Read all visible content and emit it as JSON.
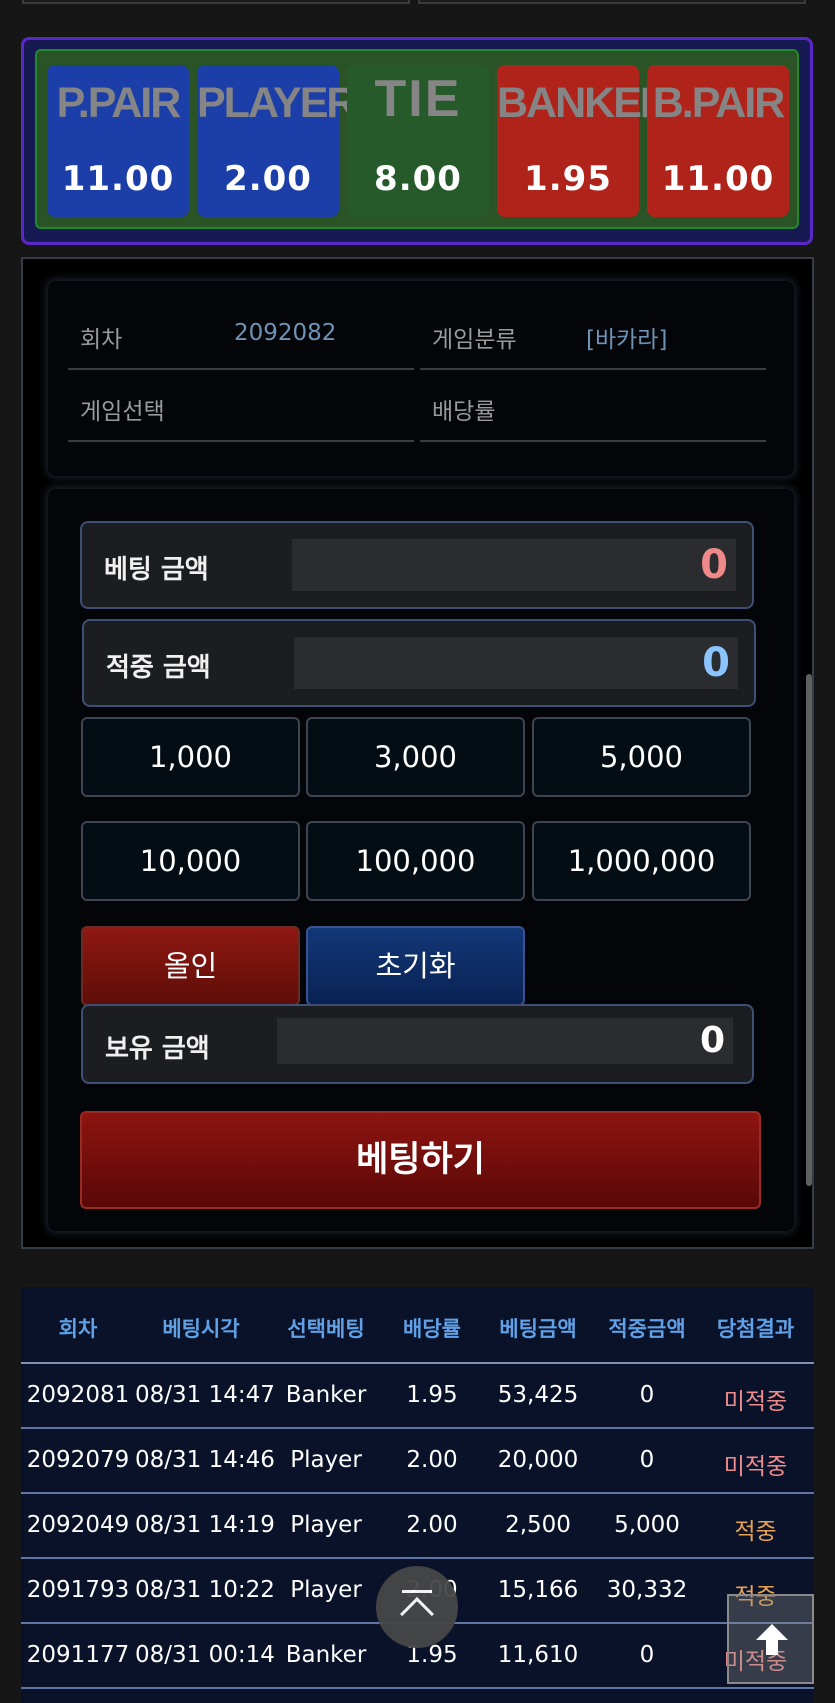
{
  "odds": [
    {
      "name": "P.PAIR",
      "value": "11.00",
      "color": "#1c3ea8"
    },
    {
      "name": "PLAYER",
      "value": "2.00",
      "color": "#1c3ea8"
    },
    {
      "name": "TIE",
      "value": "8.00",
      "color": "#265a2b"
    },
    {
      "name": "BANKER",
      "value": "1.95",
      "color": "#b0231b"
    },
    {
      "name": "B.PAIR",
      "value": "11.00",
      "color": "#b0231b"
    }
  ],
  "info": {
    "round_label": "회차",
    "round_value": "2092082",
    "category_label": "게임분류",
    "category_value": "[바카라]",
    "selection_label": "게임선택",
    "selection_value": "",
    "payout_label": "배당률",
    "payout_value": ""
  },
  "bet": {
    "bet_amount_label": "베팅 금액",
    "bet_amount_value": "0",
    "win_amount_label": "적중 금액",
    "win_amount_value": "0",
    "chips": [
      "1,000",
      "3,000",
      "5,000",
      "10,000",
      "100,000",
      "1,000,000"
    ],
    "all_in_label": "올인",
    "reset_label": "초기화",
    "balance_label": "보유 금액",
    "balance_value": "0",
    "submit_label": "베팅하기"
  },
  "history": {
    "headers": [
      "회차",
      "베팅시각",
      "선택베팅",
      "배당률",
      "베팅금액",
      "적중금액",
      "당첨결과"
    ],
    "rows": [
      {
        "round": "2092081",
        "time": "08/31 14:47",
        "pick": "Banker",
        "odds": "1.95",
        "bet": "53,425",
        "win": "0",
        "result": "미적중"
      },
      {
        "round": "2092079",
        "time": "08/31 14:46",
        "pick": "Player",
        "odds": "2.00",
        "bet": "20,000",
        "win": "0",
        "result": "미적중"
      },
      {
        "round": "2092049",
        "time": "08/31 14:19",
        "pick": "Player",
        "odds": "2.00",
        "bet": "2,500",
        "win": "5,000",
        "result": "적중"
      },
      {
        "round": "2091793",
        "time": "08/31 10:22",
        "pick": "Player",
        "odds": "2.00",
        "bet": "15,166",
        "win": "30,332",
        "result": "적중"
      },
      {
        "round": "2091177",
        "time": "08/31 00:14",
        "pick": "Banker",
        "odds": "1.95",
        "bet": "11,610",
        "win": "0",
        "result": "미적중"
      }
    ]
  },
  "colors": {
    "miss": "#ee8c8c",
    "hit": "#e5a254",
    "bet_amount": "#f08a8a",
    "win_amount": "#8cc4ff"
  }
}
